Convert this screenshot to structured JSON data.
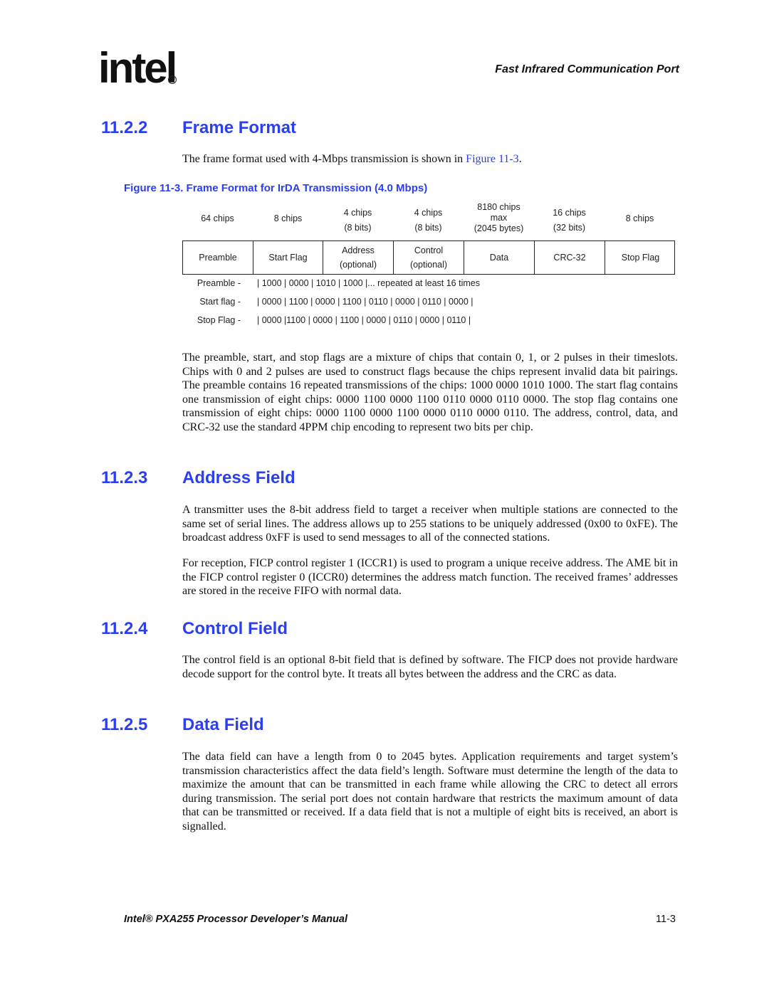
{
  "header": {
    "logo_text": "intel",
    "logo_mark": "®",
    "running_title": "Fast Infrared Communication Port"
  },
  "sections": [
    {
      "number": "11.2.2",
      "title": "Frame Format",
      "intro_before_link": "The frame format used with 4-Mbps transmission is shown in ",
      "intro_link": "Figure 11-3",
      "intro_after_link": ".",
      "paragraphs": [
        "The preamble, start, and stop flags are a mixture of chips that contain 0, 1, or 2 pulses in their timeslots. Chips with 0 and 2 pulses are used to construct flags because the chips represent invalid data bit pairings. The preamble contains 16 repeated transmissions of the chips: 1000 0000 1010 1000. The start flag contains one transmission of eight chips: 0000 1100 0000 1100 0110 0000 0110 0000. The stop flag contains one transmission of eight chips: 0000 1100 0000 1100 0000 0110 0000 0110. The address, control, data, and CRC-32 use the standard 4PPM chip encoding to represent two bits per chip."
      ]
    },
    {
      "number": "11.2.3",
      "title": "Address Field",
      "paragraphs": [
        "A transmitter uses the 8-bit address field to target a receiver when multiple stations are connected to the same set of serial lines. The address allows up to 255 stations to be uniquely addressed (0x00 to 0xFE). The broadcast address 0xFF is used to send messages to all of the connected stations.",
        "For reception, FICP control register 1 (ICCR1) is used to program a unique receive address. The AME bit in the FICP control register 0 (ICCR0) determines the address match function. The received frames’ addresses are stored in the receive FIFO with normal data."
      ]
    },
    {
      "number": "11.2.4",
      "title": "Control Field",
      "paragraphs": [
        "The control field is an optional 8-bit field that is defined by software. The FICP does not provide hardware decode support for the control byte. It treats all bytes between the address and the CRC as data."
      ]
    },
    {
      "number": "11.2.5",
      "title": "Data Field",
      "paragraphs": [
        "The data field can have a length from 0 to 2045 bytes. Application requirements and target system’s transmission characteristics affect the data field’s length. Software must determine the length of the data to maximize the amount that can be transmitted in each frame while allowing the CRC to detect all errors during transmission. The serial port does not contain hardware that restricts the maximum amount of data that can be transmitted or received. If a data field that is not a multiple of eight bits is received, an abort is signalled."
      ]
    }
  ],
  "figure": {
    "caption": "Figure 11-3. Frame Format for IrDA Transmission (4.0 Mbps)",
    "fields": [
      {
        "size": [
          "64 chips"
        ],
        "name": [
          "Preamble"
        ]
      },
      {
        "size": [
          "8 chips"
        ],
        "name": [
          "Start Flag"
        ]
      },
      {
        "size": [
          "4 chips",
          "(8 bits)"
        ],
        "name": [
          "Address",
          "(optional)"
        ]
      },
      {
        "size": [
          "4 chips",
          "(8 bits)"
        ],
        "name": [
          "Control",
          "(optional)"
        ]
      },
      {
        "size": [
          "8180 chips",
          "max",
          "(2045 bytes)"
        ],
        "name": [
          "Data"
        ]
      },
      {
        "size": [
          "16 chips",
          "(32 bits)"
        ],
        "name": [
          "CRC-32"
        ]
      },
      {
        "size": [
          "8 chips"
        ],
        "name": [
          "Stop Flag"
        ]
      }
    ],
    "sequences": [
      {
        "label": "Preamble -",
        "value": "| 1000 | 0000 | 1010 | 1000 |... repeated at least 16 times"
      },
      {
        "label": "Start flag -",
        "value": "| 0000 | 1100 | 0000 | 1100 | 0110 | 0000 | 0110 | 0000 |"
      },
      {
        "label": "Stop Flag -",
        "value": "| 0000 |1100 | 0000 | 1100 | 0000 | 0110 | 0000 | 0110 |"
      }
    ]
  },
  "footer": {
    "manual_title": "Intel® PXA255 Processor Developer’s Manual",
    "page_number": "11-3"
  }
}
